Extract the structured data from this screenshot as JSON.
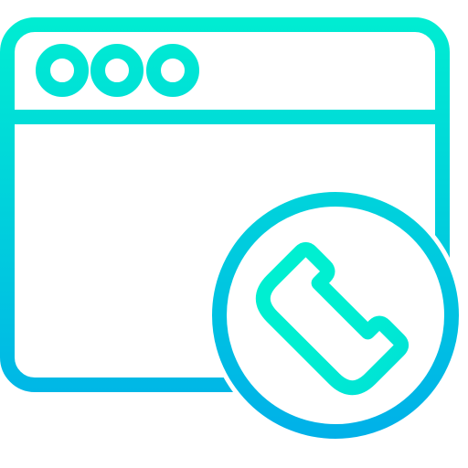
{
  "icon": {
    "name": "browser-phone-icon",
    "gradient": {
      "top_color": "#00EFD1",
      "bottom_color": "#00ACEA"
    },
    "parts": {
      "window": "browser-window-icon",
      "title_bar_dots": [
        "dot-icon",
        "dot-icon",
        "dot-icon"
      ],
      "badge": "phone-badge-icon",
      "handset": "phone-handset-icon"
    }
  }
}
